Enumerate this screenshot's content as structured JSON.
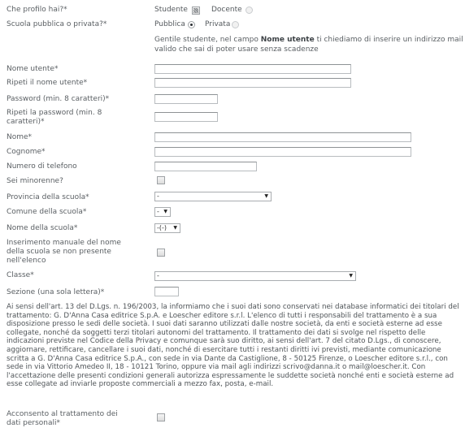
{
  "profile": {
    "label": "Che profilo hai?*",
    "options": [
      {
        "label": "Studente",
        "checked": true
      },
      {
        "label": "Docente",
        "checked": false
      }
    ]
  },
  "school_type": {
    "label": "Scuola pubblica o privata?*",
    "options": [
      {
        "label": "Pubblica",
        "checked": true
      },
      {
        "label": "Privata",
        "checked": false
      }
    ]
  },
  "info_note": {
    "pre": "Gentile studente, nel campo ",
    "bold": "Nome utente",
    "post": " ti chiediamo di inserire un indirizzo mail valido che sai di poter usare senza scadenze"
  },
  "fields": {
    "username": {
      "label": "Nome utente*",
      "value": ""
    },
    "username_repeat": {
      "label": "Ripeti il nome utente*",
      "value": ""
    },
    "password": {
      "label": "Password (min. 8 caratteri)*",
      "value": ""
    },
    "password_repeat": {
      "label": "Ripeti la password (min. 8 caratteri)*",
      "value": ""
    },
    "first_name": {
      "label": "Nome*",
      "value": ""
    },
    "last_name": {
      "label": "Cognome*",
      "value": ""
    },
    "phone": {
      "label": "Numero di telefono",
      "value": ""
    },
    "minor": {
      "label": "Sei minorenne?"
    },
    "province": {
      "label": "Provincia della scuola*",
      "selected": "-"
    },
    "municipality": {
      "label": "Comune della scuola*",
      "selected": "-"
    },
    "school_name": {
      "label": "Nome della scuola*",
      "selected": "-(-)"
    },
    "manual_school": {
      "label": "Inserimento manuale del nome della scuola se non presente nell'elenco"
    },
    "class": {
      "label": "Classe*",
      "selected": "-"
    },
    "section": {
      "label": "Sezione (una sola lettera)*",
      "value": ""
    }
  },
  "legal_text": "Ai sensi dell'art. 13 del D.Lgs. n. 196/2003, la informiamo che i suoi dati sono conservati nei database informatici dei titolari del trattamento: G. D'Anna Casa editrice S.p.A. e Loescher editore s.r.l. L'elenco di tutti i responsabili del trattamento è a sua disposizione presso le sedi delle società. I suoi dati saranno utilizzati dalle nostre società, da enti e società esterne ad esse collegate, nonché da soggetti terzi titolari autonomi del trattamento. Il trattamento dei dati si svolge nel rispetto delle indicazioni previste nel Codice della Privacy e comunque sarà suo diritto, ai sensi dell'art. 7 del citato D.Lgs., di conoscere, aggiornare, rettificare, cancellare i suoi dati, nonché di esercitare tutti i restanti diritti ivi previsti, mediante comunicazione scritta a G. D'Anna Casa editrice S.p.A., con sede in via Dante da Castiglione, 8 - 50125 Firenze, o Loescher editore s.r.l., con sede in via Vittorio Amedeo II, 18 - 10121 Torino, oppure via mail agli indirizzi scrivo@danna.it o mail@loescher.it. Con l'accettazione delle presenti condizioni generali autorizza espressamente le suddette società nonché enti e società esterne ad esse collegate ad inviarle proposte commerciali a mezzo fax, posta, e-mail.",
  "consent": {
    "label": "Acconsento al trattamento dei dati personali*"
  }
}
